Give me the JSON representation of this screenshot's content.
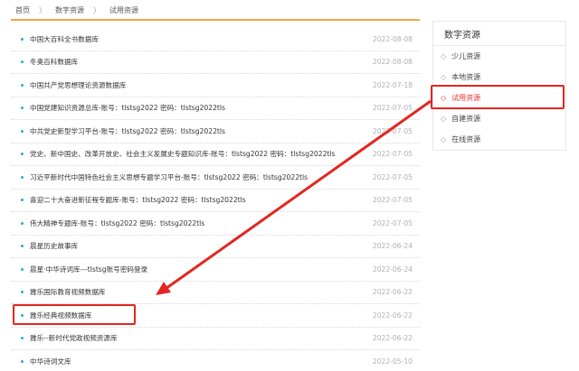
{
  "breadcrumb": {
    "home": "首页",
    "level1": "数字资源",
    "level2": "试用资源",
    "separator": "〉"
  },
  "list": [
    {
      "title": "中国大百科全书数据库",
      "date": "2022-08-08"
    },
    {
      "title": "冬奥百科数据库",
      "date": "2022-08-08"
    },
    {
      "title": "中国共产党思想理论资源数据库",
      "date": "2022-07-18"
    },
    {
      "title": "中国党建知识资源总库-账号：tlstsg2022  密码：tlstsg2022tls",
      "date": "2022-07-05"
    },
    {
      "title": "中共党史新型学习平台-账号：tlstsg2022  密码：tlstsg2022tls",
      "date": "2022-07-05"
    },
    {
      "title": "党史、新中国史、改革开放史、社会主义发展史专题知识库-账号：tlstsg2022  密码：tlstsg2022tls",
      "date": "2022-07-05"
    },
    {
      "title": "习近平新时代中国特色社会主义思想专题学习平台-账号：tlstsg2022  密码：tlstsg2022tls",
      "date": "2022-07-05"
    },
    {
      "title": "喜迎二十大奋进新征程专题库-账号：tlstsg2022  密码：tlstsg2022tls",
      "date": "2022-07-05"
    },
    {
      "title": "伟大精神专题库-账号：tlstsg2022  密码：tlstsg2022tls",
      "date": "2022-07-05"
    },
    {
      "title": "晨星历史故事库",
      "date": "2022-06-24"
    },
    {
      "title": "晨星·中华诗词库---tlstsg账号密码登录",
      "date": "2022-06-24"
    },
    {
      "title": "雅乐国际教育视频数据库",
      "date": "2022-06-22"
    },
    {
      "title": "雅乐经典视频数据库",
      "date": "2022-06-22"
    },
    {
      "title": "雅乐--新时代党政视频资源库",
      "date": "2022-06-22"
    },
    {
      "title": "中华诗词文库",
      "date": "2022-05-10"
    }
  ],
  "sidebar": {
    "title": "数字资源",
    "items": [
      {
        "label": "少儿资源"
      },
      {
        "label": "本地资源"
      },
      {
        "label": "试用资源",
        "active": true
      },
      {
        "label": "自建资源"
      },
      {
        "label": "在线资源"
      }
    ]
  },
  "colors": {
    "accent_orange": "#f3a54b",
    "bullet_blue": "#2aa9d6",
    "highlight_red": "#e3261f",
    "active_red": "#e5322d",
    "date_gray": "#b0b0b0"
  },
  "icons": {
    "bullet": "dot-icon",
    "sidebar_arrow": "chevron-right-icon"
  }
}
